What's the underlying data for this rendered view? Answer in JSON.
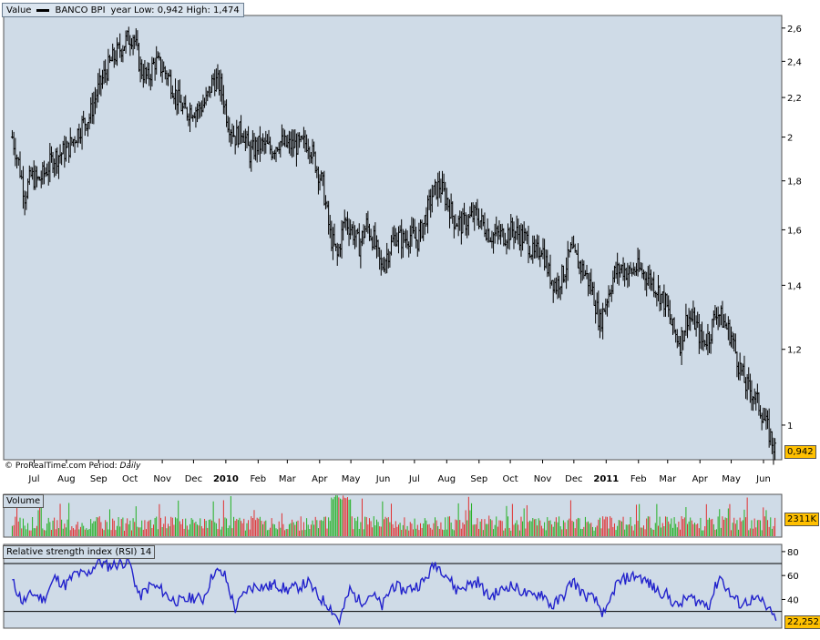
{
  "header": {
    "value_label": "Value",
    "series_name": "BANCO BPI",
    "range_text": "year Low: 0,942 High: 1,474"
  },
  "footer": {
    "source": "ProRealTime.com",
    "period_label": "Period:",
    "period_value": "Daily"
  },
  "last_price": "0,942",
  "volume": {
    "label": "Volume",
    "last": "2311K"
  },
  "rsi": {
    "label": "Relative strength index (RSI) 14",
    "last": "22,2523"
  },
  "colors": {
    "panel_bg": "#cfdbe7",
    "up": "#22b022",
    "down": "#e03030",
    "rsi_line": "#2222cc",
    "badge": "#ffc000"
  },
  "chart_data": [
    {
      "type": "ohlc",
      "title": "BANCO BPI",
      "x_ticks": [
        "Jul",
        "Aug",
        "Sep",
        "Oct",
        "Nov",
        "Dec",
        "2010",
        "Feb",
        "Mar",
        "Apr",
        "May",
        "Jun",
        "Jul",
        "Aug",
        "Sep",
        "Oct",
        "Nov",
        "Dec",
        "2011",
        "Feb",
        "Mar",
        "Apr",
        "May",
        "Jun"
      ],
      "y_ticks": [
        "2,6",
        "2,4",
        "2,2",
        "2",
        "1,8",
        "1,6",
        "1,4",
        "1,2",
        "1"
      ],
      "ylim": [
        0.92,
        2.68
      ],
      "log_scale": true,
      "grid": false,
      "series": [
        {
          "name": "BANCO BPI",
          "points": [
            [
              "2009-06-25",
              2.0
            ],
            [
              "2009-07-01",
              1.88
            ],
            [
              "2009-07-07",
              1.74
            ],
            [
              "2009-07-13",
              1.82
            ],
            [
              "2009-07-20",
              1.8
            ],
            [
              "2009-07-27",
              1.84
            ],
            [
              "2009-08-03",
              1.9
            ],
            [
              "2009-08-10",
              1.92
            ],
            [
              "2009-08-17",
              1.94
            ],
            [
              "2009-08-24",
              2.0
            ],
            [
              "2009-08-31",
              2.06
            ],
            [
              "2009-09-07",
              2.1
            ],
            [
              "2009-09-14",
              2.22
            ],
            [
              "2009-09-21",
              2.32
            ],
            [
              "2009-09-28",
              2.4
            ],
            [
              "2009-10-05",
              2.46
            ],
            [
              "2009-10-12",
              2.52
            ],
            [
              "2009-10-19",
              2.56
            ],
            [
              "2009-10-26",
              2.36
            ],
            [
              "2009-11-02",
              2.3
            ],
            [
              "2009-11-09",
              2.4
            ],
            [
              "2009-11-16",
              2.36
            ],
            [
              "2009-11-23",
              2.3
            ],
            [
              "2009-11-30",
              2.2
            ],
            [
              "2009-12-07",
              2.12
            ],
            [
              "2009-12-14",
              2.14
            ],
            [
              "2009-12-21",
              2.14
            ],
            [
              "2009-12-28",
              2.18
            ],
            [
              "2010-01-04",
              2.3
            ],
            [
              "2010-01-11",
              2.26
            ],
            [
              "2010-01-18",
              2.08
            ],
            [
              "2010-01-25",
              2.0
            ],
            [
              "2010-02-01",
              2.04
            ],
            [
              "2010-02-08",
              1.92
            ],
            [
              "2010-02-15",
              1.96
            ],
            [
              "2010-02-22",
              1.96
            ],
            [
              "2010-03-01",
              1.94
            ],
            [
              "2010-03-08",
              1.98
            ],
            [
              "2010-03-15",
              1.96
            ],
            [
              "2010-03-22",
              1.96
            ],
            [
              "2010-03-29",
              1.96
            ],
            [
              "2010-04-05",
              1.98
            ],
            [
              "2010-04-12",
              1.88
            ],
            [
              "2010-04-19",
              1.78
            ],
            [
              "2010-04-26",
              1.58
            ],
            [
              "2010-05-03",
              1.5
            ],
            [
              "2010-05-10",
              1.64
            ],
            [
              "2010-05-17",
              1.6
            ],
            [
              "2010-05-24",
              1.54
            ],
            [
              "2010-05-31",
              1.62
            ],
            [
              "2010-06-07",
              1.56
            ],
            [
              "2010-06-14",
              1.46
            ],
            [
              "2010-06-21",
              1.52
            ],
            [
              "2010-06-28",
              1.58
            ],
            [
              "2010-07-05",
              1.56
            ],
            [
              "2010-07-12",
              1.58
            ],
            [
              "2010-07-19",
              1.56
            ],
            [
              "2010-07-26",
              1.64
            ],
            [
              "2010-08-02",
              1.74
            ],
            [
              "2010-08-09",
              1.78
            ],
            [
              "2010-08-16",
              1.72
            ],
            [
              "2010-08-23",
              1.64
            ],
            [
              "2010-08-30",
              1.62
            ],
            [
              "2010-09-06",
              1.64
            ],
            [
              "2010-09-13",
              1.66
            ],
            [
              "2010-09-20",
              1.62
            ],
            [
              "2010-09-27",
              1.58
            ],
            [
              "2010-10-04",
              1.58
            ],
            [
              "2010-10-11",
              1.58
            ],
            [
              "2010-10-18",
              1.6
            ],
            [
              "2010-10-25",
              1.58
            ],
            [
              "2010-11-01",
              1.56
            ],
            [
              "2010-11-08",
              1.5
            ],
            [
              "2010-11-15",
              1.54
            ],
            [
              "2010-11-22",
              1.44
            ],
            [
              "2010-11-29",
              1.4
            ],
            [
              "2010-12-06",
              1.44
            ],
            [
              "2010-12-13",
              1.52
            ],
            [
              "2010-12-20",
              1.48
            ],
            [
              "2010-12-27",
              1.44
            ],
            [
              "2011-01-03",
              1.38
            ],
            [
              "2011-01-10",
              1.28
            ],
            [
              "2011-01-17",
              1.36
            ],
            [
              "2011-01-24",
              1.44
            ],
            [
              "2011-01-31",
              1.46
            ],
            [
              "2011-02-07",
              1.44
            ],
            [
              "2011-02-14",
              1.46
            ],
            [
              "2011-02-21",
              1.44
            ],
            [
              "2011-02-28",
              1.42
            ],
            [
              "2011-03-07",
              1.38
            ],
            [
              "2011-03-14",
              1.34
            ],
            [
              "2011-03-21",
              1.26
            ],
            [
              "2011-03-28",
              1.22
            ],
            [
              "2011-04-04",
              1.3
            ],
            [
              "2011-04-11",
              1.28
            ],
            [
              "2011-04-18",
              1.22
            ],
            [
              "2011-04-25",
              1.24
            ],
            [
              "2011-05-02",
              1.32
            ],
            [
              "2011-05-09",
              1.28
            ],
            [
              "2011-05-16",
              1.24
            ],
            [
              "2011-05-23",
              1.16
            ],
            [
              "2011-05-30",
              1.1
            ],
            [
              "2011-06-06",
              1.08
            ],
            [
              "2011-06-13",
              1.04
            ],
            [
              "2011-06-20",
              0.99
            ],
            [
              "2011-06-27",
              0.942
            ]
          ]
        }
      ]
    },
    {
      "type": "bar",
      "title": "Volume",
      "last_value": "2311K"
    },
    {
      "type": "line",
      "title": "Relative strength index (RSI) 14",
      "y_ticks": [
        "80",
        "60",
        "40"
      ],
      "ylim": [
        16,
        86
      ],
      "reference_lines": [
        70,
        30
      ],
      "series": [
        {
          "name": "Relative strength index (RSI) 14",
          "points": [
            [
              "2009-06-25",
              55
            ],
            [
              "2009-07-05",
              38
            ],
            [
              "2009-07-15",
              45
            ],
            [
              "2009-07-25",
              40
            ],
            [
              "2009-08-05",
              58
            ],
            [
              "2009-08-15",
              52
            ],
            [
              "2009-08-25",
              62
            ],
            [
              "2009-09-05",
              60
            ],
            [
              "2009-09-15",
              72
            ],
            [
              "2009-09-25",
              68
            ],
            [
              "2009-10-05",
              70
            ],
            [
              "2009-10-15",
              72
            ],
            [
              "2009-10-25",
              42
            ],
            [
              "2009-11-05",
              52
            ],
            [
              "2009-11-15",
              48
            ],
            [
              "2009-11-25",
              40
            ],
            [
              "2009-12-05",
              38
            ],
            [
              "2009-12-15",
              42
            ],
            [
              "2009-12-25",
              40
            ],
            [
              "2010-01-05",
              64
            ],
            [
              "2010-01-15",
              60
            ],
            [
              "2010-01-25",
              32
            ],
            [
              "2010-02-05",
              48
            ],
            [
              "2010-02-15",
              52
            ],
            [
              "2010-02-25",
              50
            ],
            [
              "2010-03-05",
              53
            ],
            [
              "2010-03-15",
              48
            ],
            [
              "2010-03-25",
              50
            ],
            [
              "2010-04-05",
              54
            ],
            [
              "2010-04-15",
              42
            ],
            [
              "2010-04-25",
              35
            ],
            [
              "2010-05-05",
              22
            ],
            [
              "2010-05-15",
              48
            ],
            [
              "2010-05-25",
              38
            ],
            [
              "2010-06-05",
              45
            ],
            [
              "2010-06-15",
              34
            ],
            [
              "2010-06-25",
              52
            ],
            [
              "2010-07-05",
              48
            ],
            [
              "2010-07-15",
              50
            ],
            [
              "2010-07-25",
              55
            ],
            [
              "2010-08-05",
              70
            ],
            [
              "2010-08-15",
              62
            ],
            [
              "2010-08-25",
              48
            ],
            [
              "2010-09-05",
              52
            ],
            [
              "2010-09-15",
              55
            ],
            [
              "2010-09-25",
              42
            ],
            [
              "2010-10-05",
              46
            ],
            [
              "2010-10-15",
              52
            ],
            [
              "2010-10-25",
              48
            ],
            [
              "2010-11-05",
              42
            ],
            [
              "2010-11-15",
              46
            ],
            [
              "2010-11-25",
              34
            ],
            [
              "2010-12-05",
              42
            ],
            [
              "2010-12-15",
              56
            ],
            [
              "2010-12-25",
              44
            ],
            [
              "2011-01-05",
              40
            ],
            [
              "2011-01-15",
              26
            ],
            [
              "2011-01-25",
              52
            ],
            [
              "2011-02-05",
              58
            ],
            [
              "2011-02-15",
              60
            ],
            [
              "2011-02-25",
              54
            ],
            [
              "2011-03-05",
              48
            ],
            [
              "2011-03-15",
              44
            ],
            [
              "2011-03-25",
              34
            ],
            [
              "2011-04-05",
              42
            ],
            [
              "2011-04-15",
              38
            ],
            [
              "2011-04-25",
              36
            ],
            [
              "2011-05-05",
              60
            ],
            [
              "2011-05-15",
              44
            ],
            [
              "2011-05-25",
              36
            ],
            [
              "2011-06-05",
              40
            ],
            [
              "2011-06-15",
              38
            ],
            [
              "2011-06-28",
              22.2523
            ]
          ]
        }
      ]
    }
  ]
}
